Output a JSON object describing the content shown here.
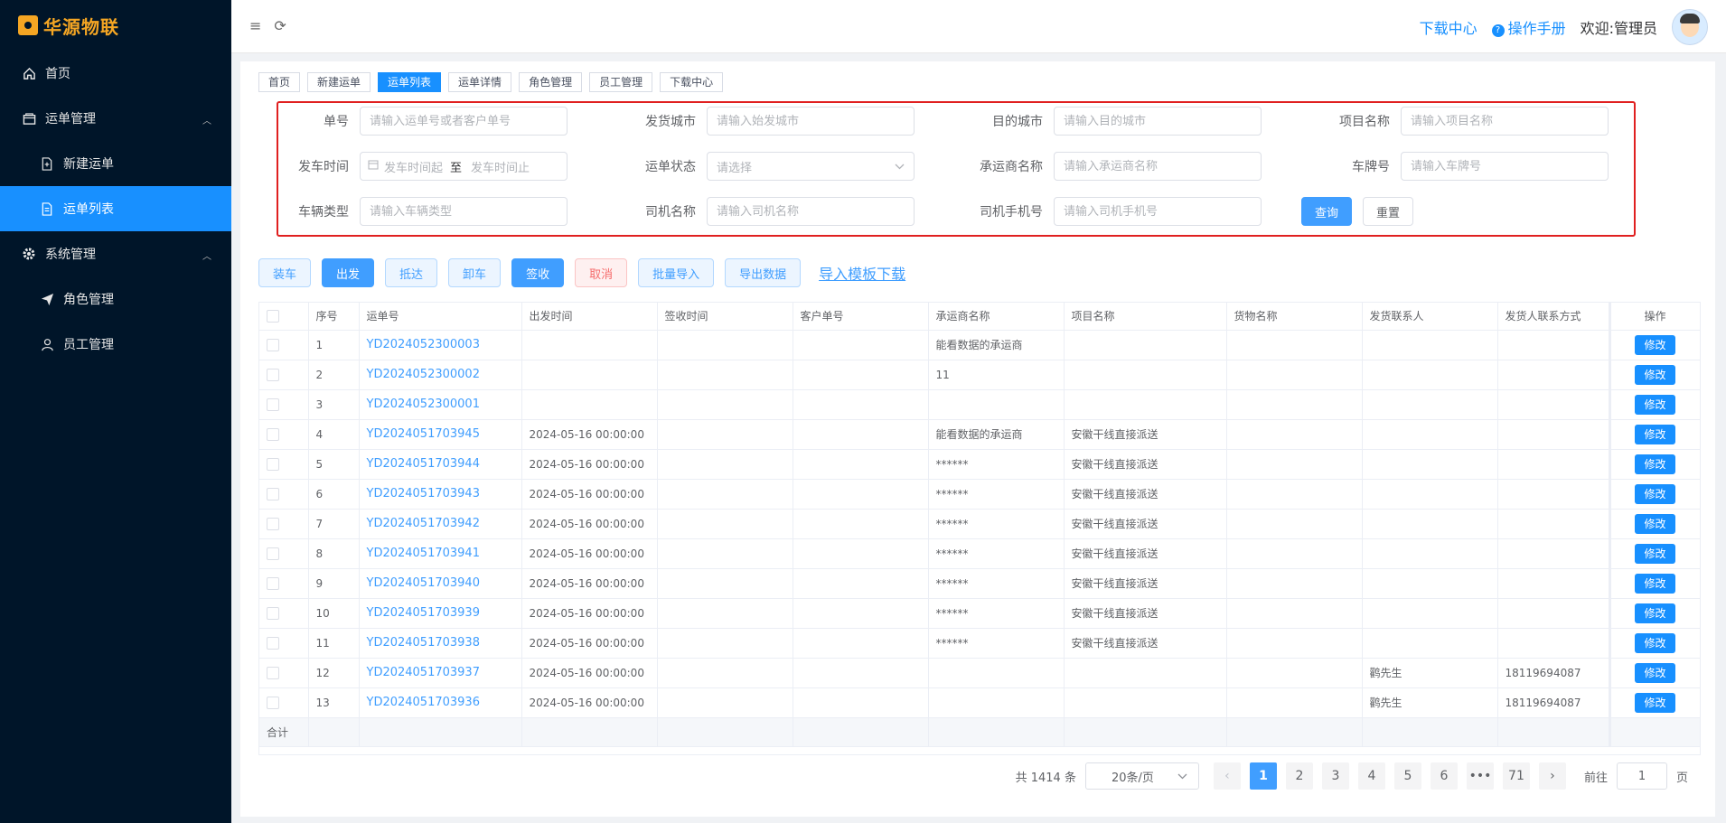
{
  "sidebar": {
    "logo_text": "华源物联",
    "items": [
      {
        "label": "首页",
        "icon": "home-icon"
      },
      {
        "label": "运单管理",
        "icon": "folder-icon"
      },
      {
        "label": "新建运单",
        "icon": "doc-add-icon"
      },
      {
        "label": "运单列表",
        "icon": "doc-icon"
      },
      {
        "label": "系统管理",
        "icon": "gear-icon"
      },
      {
        "label": "角色管理",
        "icon": "send-icon"
      },
      {
        "label": "员工管理",
        "icon": "user-icon"
      }
    ]
  },
  "header": {
    "download_center": "下载中心",
    "manual": "操作手册",
    "welcome": "欢迎:管理员"
  },
  "tags": [
    "首页",
    "新建运单",
    "运单列表",
    "运单详情",
    "角色管理",
    "员工管理",
    "下载中心"
  ],
  "filter": {
    "waybill_no": {
      "label": "单号",
      "placeholder": "请输入运单号或者客户单号"
    },
    "from_city": {
      "label": "发货城市",
      "placeholder": "请输入始发城市"
    },
    "to_city": {
      "label": "目的城市",
      "placeholder": "请输入目的城市"
    },
    "project": {
      "label": "项目名称",
      "placeholder": "请输入项目名称"
    },
    "depart_time": {
      "label": "发车时间",
      "start": "发车时间起",
      "sep": "至",
      "end": "发车时间止"
    },
    "status": {
      "label": "运单状态",
      "placeholder": "请选择"
    },
    "carrier": {
      "label": "承运商名称",
      "placeholder": "请输入承运商名称"
    },
    "plate": {
      "label": "车牌号",
      "placeholder": "请输入车牌号"
    },
    "vehicle_type": {
      "label": "车辆类型",
      "placeholder": "请输入车辆类型"
    },
    "driver": {
      "label": "司机名称",
      "placeholder": "请输入司机名称"
    },
    "driver_phone": {
      "label": "司机手机号",
      "placeholder": "请输入司机手机号"
    },
    "query_btn": "查询",
    "reset_btn": "重置"
  },
  "actions": {
    "load": "装车",
    "depart": "出发",
    "arrive": "抵达",
    "unload": "卸车",
    "sign": "签收",
    "cancel": "取消",
    "batch_import": "批量导入",
    "export": "导出数据",
    "template": "导入模板下载"
  },
  "table": {
    "columns": [
      "序号",
      "运单号",
      "出发时间",
      "签收时间",
      "客户单号",
      "承运商名称",
      "项目名称",
      "货物名称",
      "发货联系人",
      "发货人联系方式",
      "操作"
    ],
    "edit_label": "修改",
    "sum_label": "合计",
    "rows": [
      {
        "no": "1",
        "waybill": "YD2024052300003",
        "depart": "",
        "sign": "",
        "customer": "",
        "carrier": "能看数据的承运商",
        "project": "",
        "goods": "",
        "contact": "",
        "phone": ""
      },
      {
        "no": "2",
        "waybill": "YD2024052300002",
        "depart": "",
        "sign": "",
        "customer": "",
        "carrier": "11",
        "project": "",
        "goods": "",
        "contact": "",
        "phone": ""
      },
      {
        "no": "3",
        "waybill": "YD2024052300001",
        "depart": "",
        "sign": "",
        "customer": "",
        "carrier": "",
        "project": "",
        "goods": "",
        "contact": "",
        "phone": ""
      },
      {
        "no": "4",
        "waybill": "YD2024051703945",
        "depart": "2024-05-16 00:00:00",
        "sign": "",
        "customer": "",
        "carrier": "能看数据的承运商",
        "project": "安徽干线直接派送",
        "goods": "",
        "contact": "",
        "phone": ""
      },
      {
        "no": "5",
        "waybill": "YD2024051703944",
        "depart": "2024-05-16 00:00:00",
        "sign": "",
        "customer": "",
        "carrier": "******",
        "project": "安徽干线直接派送",
        "goods": "",
        "contact": "",
        "phone": ""
      },
      {
        "no": "6",
        "waybill": "YD2024051703943",
        "depart": "2024-05-16 00:00:00",
        "sign": "",
        "customer": "",
        "carrier": "******",
        "project": "安徽干线直接派送",
        "goods": "",
        "contact": "",
        "phone": ""
      },
      {
        "no": "7",
        "waybill": "YD2024051703942",
        "depart": "2024-05-16 00:00:00",
        "sign": "",
        "customer": "",
        "carrier": "******",
        "project": "安徽干线直接派送",
        "goods": "",
        "contact": "",
        "phone": ""
      },
      {
        "no": "8",
        "waybill": "YD2024051703941",
        "depart": "2024-05-16 00:00:00",
        "sign": "",
        "customer": "",
        "carrier": "******",
        "project": "安徽干线直接派送",
        "goods": "",
        "contact": "",
        "phone": ""
      },
      {
        "no": "9",
        "waybill": "YD2024051703940",
        "depart": "2024-05-16 00:00:00",
        "sign": "",
        "customer": "",
        "carrier": "******",
        "project": "安徽干线直接派送",
        "goods": "",
        "contact": "",
        "phone": ""
      },
      {
        "no": "10",
        "waybill": "YD2024051703939",
        "depart": "2024-05-16 00:00:00",
        "sign": "",
        "customer": "",
        "carrier": "******",
        "project": "安徽干线直接派送",
        "goods": "",
        "contact": "",
        "phone": ""
      },
      {
        "no": "11",
        "waybill": "YD2024051703938",
        "depart": "2024-05-16 00:00:00",
        "sign": "",
        "customer": "",
        "carrier": "******",
        "project": "安徽干线直接派送",
        "goods": "",
        "contact": "",
        "phone": ""
      },
      {
        "no": "12",
        "waybill": "YD2024051703937",
        "depart": "2024-05-16 00:00:00",
        "sign": "",
        "customer": "",
        "carrier": "",
        "project": "",
        "goods": "",
        "contact": "鹳先生",
        "phone": "18119694087"
      },
      {
        "no": "13",
        "waybill": "YD2024051703936",
        "depart": "2024-05-16 00:00:00",
        "sign": "",
        "customer": "",
        "carrier": "",
        "project": "",
        "goods": "",
        "contact": "鹳先生",
        "phone": "18119694087"
      }
    ]
  },
  "pagination": {
    "total": "共 1414 条",
    "page_size": "20条/页",
    "pages": [
      "1",
      "2",
      "3",
      "4",
      "5",
      "6",
      "•••",
      "71"
    ],
    "current": "1",
    "goto_label": "前往",
    "goto_value": "1",
    "page_suffix": "页"
  }
}
